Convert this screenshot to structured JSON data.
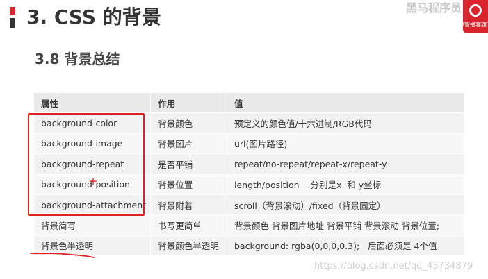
{
  "header": {
    "title": "3. CSS 的背景",
    "section": "3.8 背景总结"
  },
  "logo": {
    "text": "黑马程序员",
    "sub": "传智播客旗下"
  },
  "table": {
    "headers": [
      "属性",
      "作用",
      "值"
    ],
    "rows": [
      [
        "background-color",
        "背景颜色",
        "预定义的颜色值/十六进制/RGB代码"
      ],
      [
        "background-image",
        "背景图片",
        "url(图片路径)"
      ],
      [
        "background-repeat",
        "是否平铺",
        "repeat/no-repeat/repeat-x/repeat-y"
      ],
      [
        "background-position",
        "背景位置",
        "length/position    分别是x  和 y坐标"
      ],
      [
        "background-attachment",
        "背景附着",
        "scroll（背景滚动）/fixed（背景固定）"
      ],
      [
        "背景简写",
        "书写更简单",
        "背景颜色 背景图片地址 背景平铺 背景滚动 背景位置;"
      ],
      [
        "背景色半透明",
        "背景颜色半透明",
        "background: rgba(0,0,0,0.3);   后面必须是 4个值"
      ]
    ]
  },
  "watermark": "https://blog.csdn.net/qq_45734879",
  "colors": {
    "accent": "#d9232d",
    "highlight": "#e02020",
    "header_bg": "#e9e9e9",
    "row_bg": "#f2f2f2"
  }
}
